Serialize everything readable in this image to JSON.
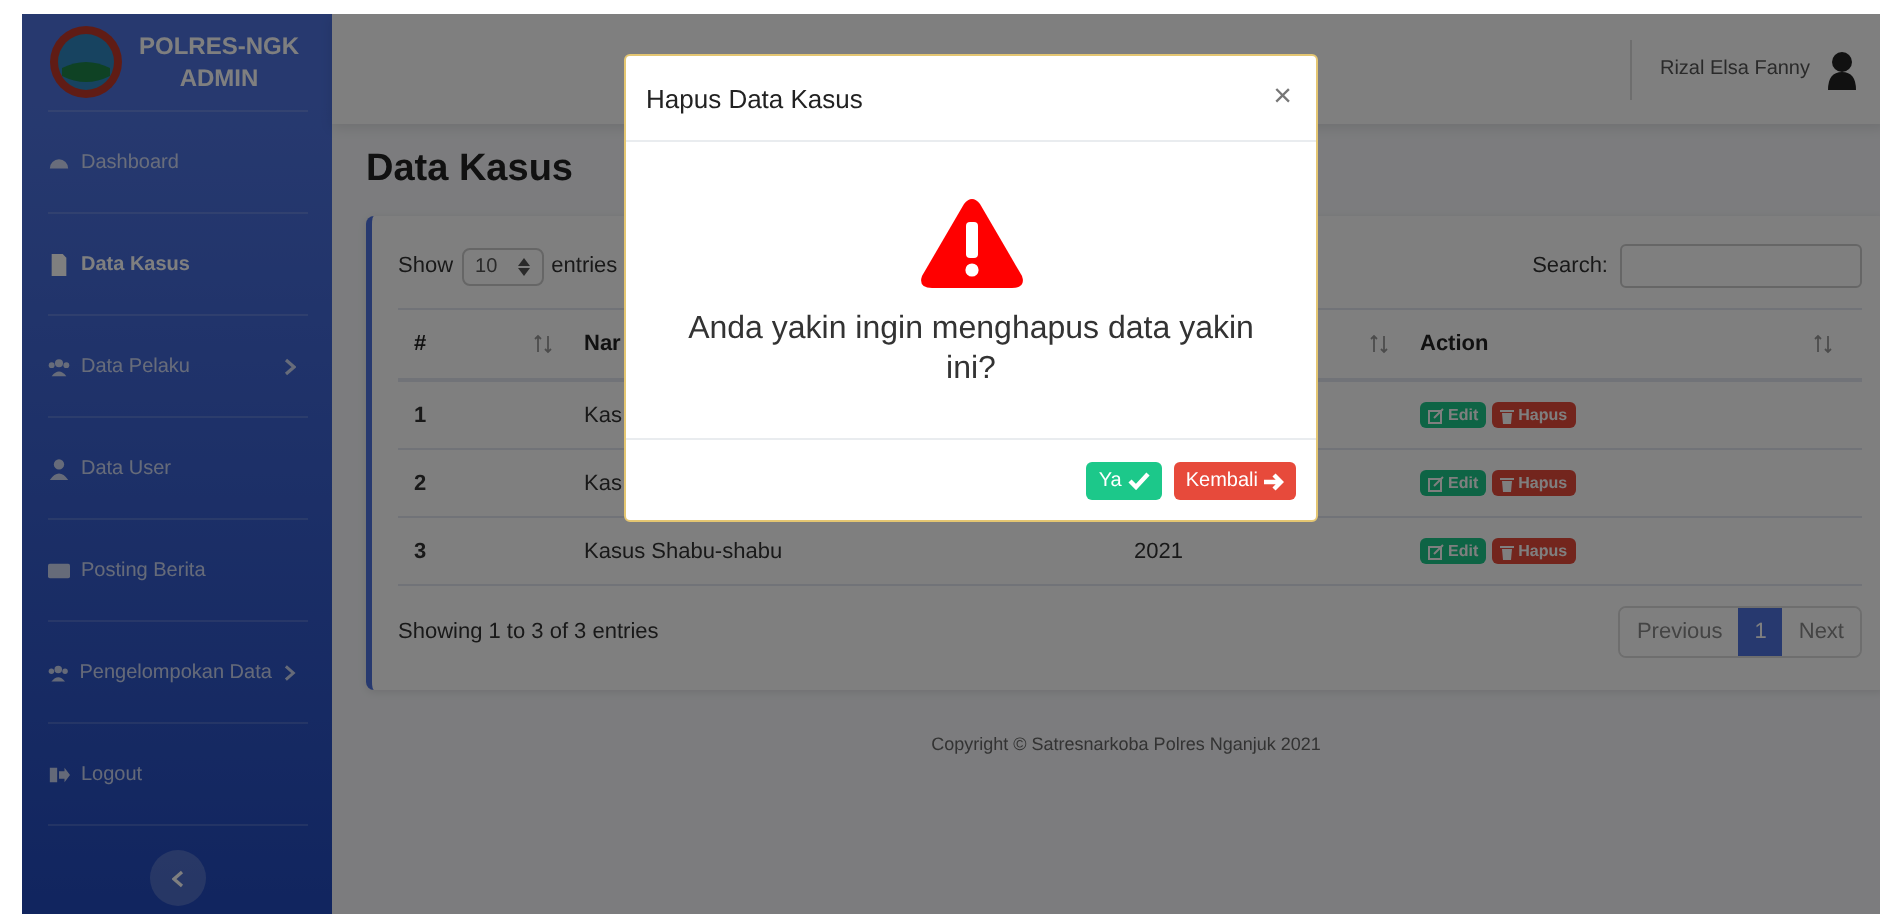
{
  "sidebar": {
    "brand": [
      "POLRES-NGK",
      "ADMIN"
    ],
    "items": [
      {
        "label": "Dashboard",
        "selected": false,
        "submenu": false
      },
      {
        "label": "Data Kasus",
        "selected": true,
        "submenu": false
      },
      {
        "label": "Data Pelaku",
        "selected": false,
        "submenu": true
      },
      {
        "label": "Data User",
        "selected": false,
        "submenu": false
      },
      {
        "label": "Posting Berita",
        "selected": false,
        "submenu": false
      },
      {
        "label": "Pengelompokan Data",
        "selected": false,
        "submenu": true
      },
      {
        "label": "Logout",
        "selected": false,
        "submenu": false
      }
    ]
  },
  "topbar": {
    "user_name": "Rizal Elsa Fanny"
  },
  "page_title": "Data Kasus",
  "table_controls": {
    "show_label": "Show",
    "page_length": "10",
    "entries_label": "entries",
    "search_label": "Search:"
  },
  "table": {
    "columns": [
      {
        "label": "#",
        "sortable": true
      },
      {
        "label": "Nar"
      },
      {
        "sortable": true
      },
      {
        "label": "Action",
        "sortable": true
      }
    ],
    "rows": [
      {
        "number": "1",
        "name": "Kas",
        "actions": [
          {
            "label": "Edit",
            "kind": "edit"
          },
          {
            "label": "Hapus",
            "kind": "delete"
          }
        ]
      },
      {
        "number": "2",
        "name": "Kas",
        "actions": [
          {
            "label": "Edit",
            "kind": "edit"
          },
          {
            "label": "Hapus",
            "kind": "delete"
          }
        ]
      },
      {
        "number": "3",
        "name": "Kasus Shabu-shabu",
        "column_3": "2021",
        "actions": [
          {
            "label": "Edit",
            "kind": "edit"
          },
          {
            "label": "Hapus",
            "kind": "delete"
          }
        ]
      }
    ]
  },
  "table_info": "Showing 1 to 3 of 3 entries",
  "pagination": [
    {
      "label": "Previous",
      "selected": false
    },
    {
      "label": "1",
      "selected": true
    },
    {
      "label": "Next",
      "selected": false
    }
  ],
  "footer": "Copyright © Satresnarkoba Polres Nganjuk 2021",
  "modal": {
    "title": "Hapus Data Kasus",
    "close": "×",
    "message": "Anda yakin ingin menghapus data yakin ini?",
    "buttons": [
      {
        "label": "Ya",
        "kind": "confirm"
      },
      {
        "label": "Kembali",
        "kind": "cancel"
      }
    ]
  }
}
